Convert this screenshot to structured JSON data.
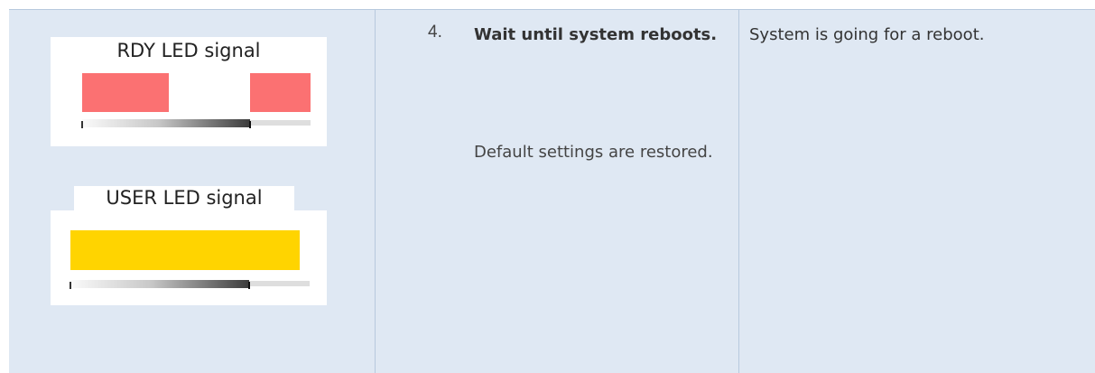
{
  "rdy_panel": {
    "label": "RDY LED signal",
    "blink_color": "#fb7172"
  },
  "user_panel": {
    "label": "USER LED signal",
    "steady_color": "#ffd400"
  },
  "step": {
    "number": "4.",
    "title": "Wait until system reboots.",
    "detail": "Default settings are restored."
  },
  "result": {
    "text": "System is going for a reboot."
  }
}
